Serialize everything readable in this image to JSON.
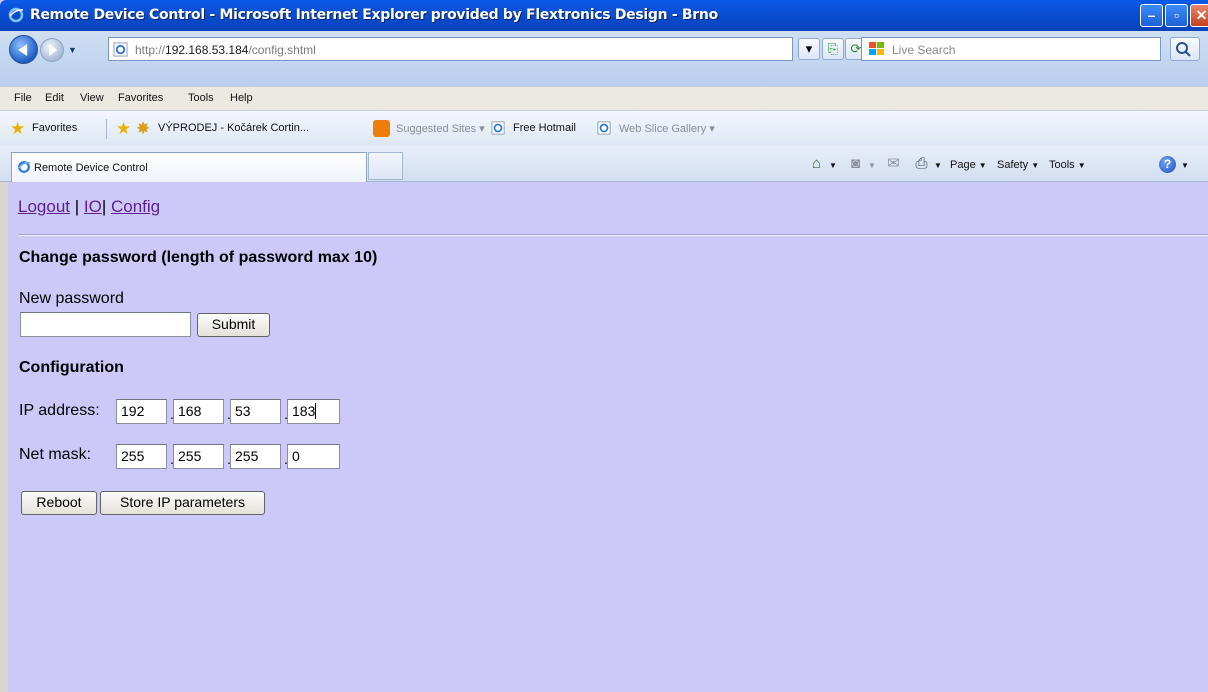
{
  "window": {
    "title": "Remote Device Control - Microsoft Internet Explorer provided by Flextronics Design - Brno",
    "min_glyph": "–",
    "max_glyph": "▫",
    "close_glyph": "✕"
  },
  "address_bar": {
    "url_prefix": "http://",
    "url_host": "192.168.53.184",
    "url_path": "/config.shtml",
    "search_placeholder": "Live Search"
  },
  "menu": [
    "File",
    "Edit",
    "View",
    "Favorites",
    "Tools",
    "Help"
  ],
  "favorites_bar": {
    "favorites_label": "Favorites",
    "items": [
      "VÝPRODEJ - Kočárek Cortin...",
      "Suggested Sites ▾",
      "Free Hotmail",
      "Web Slice Gallery ▾"
    ]
  },
  "tab": {
    "title": "Remote Device Control"
  },
  "command_bar": {
    "page_label": "Page",
    "safety_label": "Safety",
    "tools_label": "Tools"
  },
  "page": {
    "nav": {
      "logout": "Logout",
      "separator": "|",
      "io": "IO",
      "config": "Config"
    },
    "password_section": {
      "heading": "Change password (length of password max 10)",
      "label": "New password",
      "value": "",
      "submit_label": "Submit"
    },
    "config_section": {
      "heading": "Configuration",
      "ip_label": "IP address:",
      "ip": [
        "192",
        "168",
        "53",
        "183"
      ],
      "mask_label": "Net mask:",
      "mask": [
        "255",
        "255",
        "255",
        "0"
      ],
      "reboot_label": "Reboot",
      "store_label": "Store IP parameters"
    }
  }
}
